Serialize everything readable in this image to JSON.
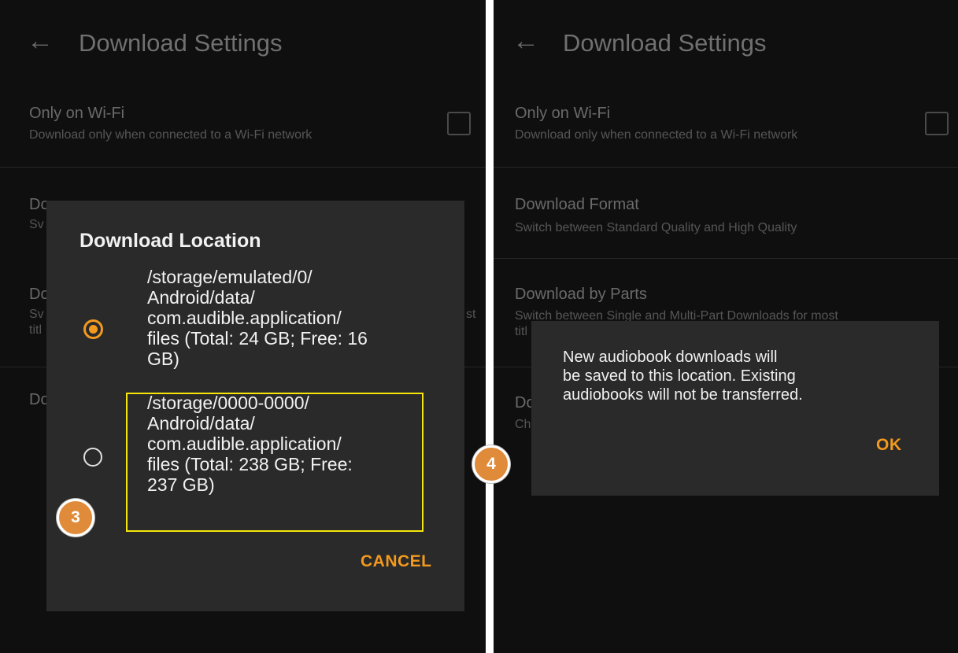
{
  "screen_left": {
    "header": {
      "back_icon": "←",
      "title": "Download Settings"
    },
    "settings": {
      "wifi_title": "Only on Wi-Fi",
      "wifi_subtitle": "Download only when connected to a Wi-Fi network",
      "format_title_partial": "Do",
      "format_subtitle_partial": "Sv",
      "parts_title_partial": "Do",
      "parts_subtitle_partial_1": "Sv",
      "parts_subtitle_partial_2": "titl",
      "parts_subtitle_partial_right": "st",
      "location_title_partial": "Do"
    },
    "dialog": {
      "title": "Download Location",
      "options": [
        {
          "text": "/storage/emulated/0/\nAndroid/data/\ncom.audible.application/\nfiles (Total: 24 GB; Free: 16\nGB)",
          "selected": true
        },
        {
          "text": "/storage/0000-0000/\nAndroid/data/\ncom.audible.application/\nfiles (Total: 238 GB; Free:\n237 GB)",
          "selected": false
        }
      ],
      "cancel_label": "CANCEL"
    },
    "step_badge": "3"
  },
  "screen_right": {
    "header": {
      "back_icon": "←",
      "title": "Download Settings"
    },
    "settings": {
      "wifi_title": "Only on Wi-Fi",
      "wifi_subtitle": "Download only when connected to a Wi-Fi network",
      "format_title": "Download Format",
      "format_subtitle": "Switch between Standard Quality and High Quality",
      "parts_title": "Download by Parts",
      "parts_subtitle_1": "Switch between Single and Multi-Part Downloads for most",
      "parts_subtitle_2": "titl",
      "location_title_partial": "Do",
      "location_subtitle_partial": "Ch"
    },
    "dialog": {
      "message": "New audiobook downloads will\nbe saved to this location. Existing\naudiobooks will not be transferred.",
      "ok_label": "OK"
    },
    "step_badge": "4"
  },
  "colors": {
    "accent": "#f39a1e",
    "highlight": "#f5e50c",
    "badge": "#e08b3a"
  }
}
